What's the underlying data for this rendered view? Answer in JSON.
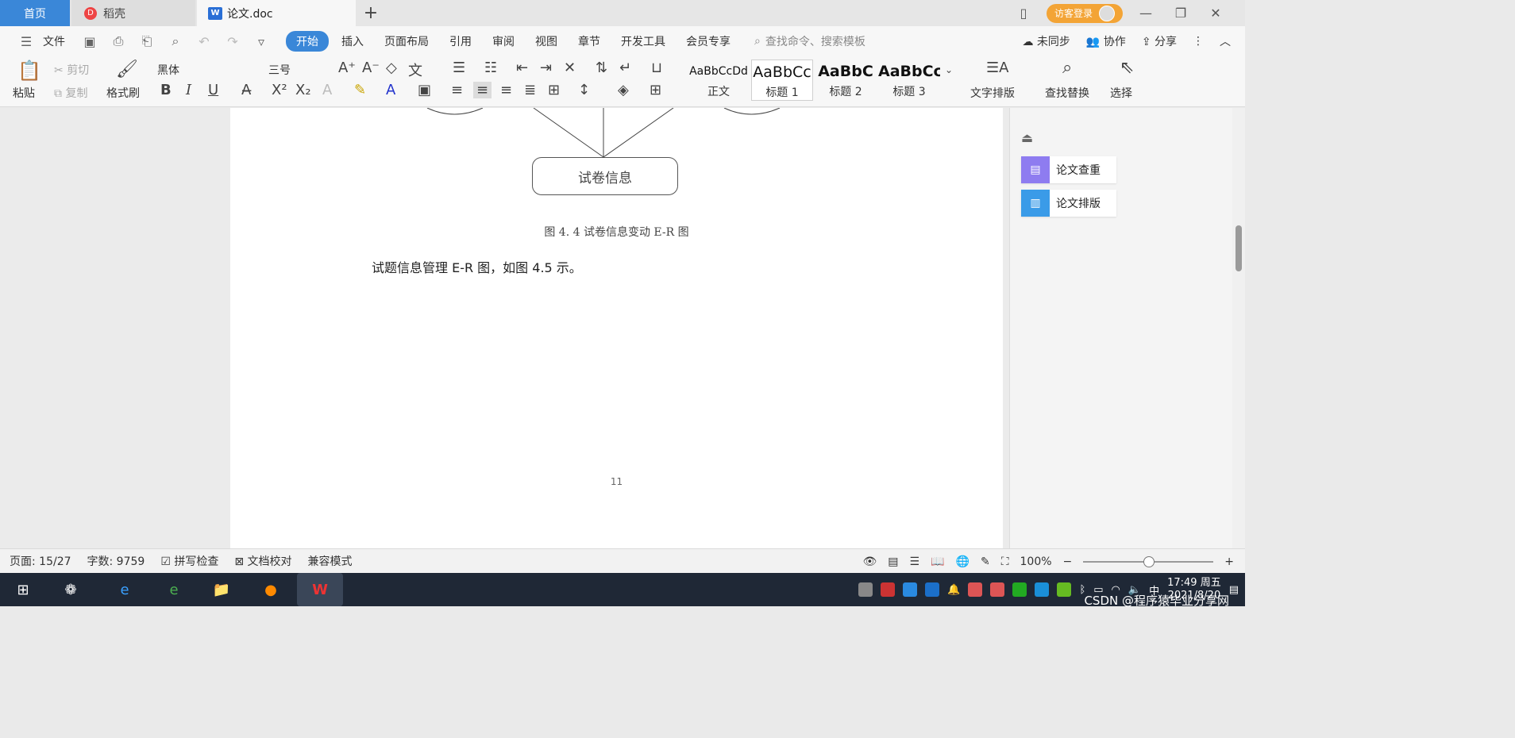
{
  "tabs": {
    "home": "首页",
    "daoke": "稻壳",
    "doc": "论文.doc",
    "add": "+"
  },
  "titlebar": {
    "visitor_label": "访客登录"
  },
  "menu": {
    "file": "文件",
    "items": [
      "开始",
      "插入",
      "页面布局",
      "引用",
      "审阅",
      "视图",
      "章节",
      "开发工具",
      "会员专享"
    ],
    "search": "查找命令、搜索模板",
    "unsync": "未同步",
    "collab": "协作",
    "share": "分享"
  },
  "ribbon": {
    "paste": "粘贴",
    "cut": "剪切",
    "copy": "复制",
    "format_painter": "格式刷",
    "font_name": "黑体",
    "font_size": "三号",
    "styles": [
      {
        "sample": "AaBbCcDd",
        "label": "正文"
      },
      {
        "sample": "AaBbCc",
        "label": "标题 1"
      },
      {
        "sample": "AaBbC",
        "label": "标题 2"
      },
      {
        "sample": "AaBbCc",
        "label": "标题 3"
      }
    ],
    "text_layout": "文字排版",
    "find_replace": "查找替换",
    "select": "选择"
  },
  "document": {
    "er_entity": "试卷信息",
    "figure_caption": "图 4. 4 试卷信息变动 E-R 图",
    "body_line": "试题信息管理 E-R 图，如图 4.5 示。",
    "page_number": "11"
  },
  "sidepanel": {
    "check": "论文查重",
    "layout": "论文排版"
  },
  "status": {
    "page": "页面: 15/27",
    "words": "字数: 9759",
    "spell": "拼写检查",
    "proof": "文档校对",
    "compat": "兼容模式",
    "zoom": "100%",
    "zoom_level": 0.5
  },
  "taskbar": {
    "time": "17:49 周五",
    "date": "2021/8/20",
    "ime": "中",
    "watermark": "CSDN @程序猿毕业分享网"
  },
  "colors": {
    "accent": "#3a87d8",
    "visitor": "#f3a436",
    "taskbar": "#1f2836"
  }
}
